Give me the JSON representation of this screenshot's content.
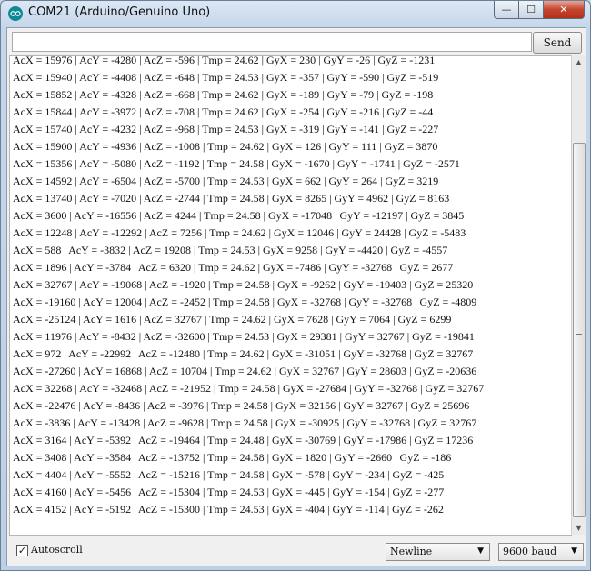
{
  "window": {
    "title": "COM21 (Arduino/Genuino Uno)"
  },
  "caption_buttons": {
    "min": "—",
    "max": "☐",
    "close": "✕"
  },
  "send": {
    "input_value": "",
    "button_label": "Send"
  },
  "output_lines": [
    "AcX = 15976 | AcY = -4280 | AcZ = -596 | Tmp = 24.62 | GyX = 230 | GyY = -26 | GyZ = -1231",
    "AcX = 15940 | AcY = -4408 | AcZ = -648 | Tmp = 24.53 | GyX = -357 | GyY = -590 | GyZ = -519",
    "AcX = 15852 | AcY = -4328 | AcZ = -668 | Tmp = 24.62 | GyX = -189 | GyY = -79 | GyZ = -198",
    "AcX = 15844 | AcY = -3972 | AcZ = -708 | Tmp = 24.62 | GyX = -254 | GyY = -216 | GyZ = -44",
    "AcX = 15740 | AcY = -4232 | AcZ = -968 | Tmp = 24.53 | GyX = -319 | GyY = -141 | GyZ = -227",
    "AcX = 15900 | AcY = -4936 | AcZ = -1008 | Tmp = 24.62 | GyX = 126 | GyY = 111 | GyZ = 3870",
    "AcX = 15356 | AcY = -5080 | AcZ = -1192 | Tmp = 24.58 | GyX = -1670 | GyY = -1741 | GyZ = -2571",
    "AcX = 14592 | AcY = -6504 | AcZ = -5700 | Tmp = 24.53 | GyX = 662 | GyY = 264 | GyZ = 3219",
    "AcX = 13740 | AcY = -7020 | AcZ = -2744 | Tmp = 24.58 | GyX = 8265 | GyY = 4962 | GyZ = 8163",
    "AcX = 3600 | AcY = -16556 | AcZ = 4244 | Tmp = 24.58 | GyX = -17048 | GyY = -12197 | GyZ = 3845",
    "AcX = 12248 | AcY = -12292 | AcZ = 7256 | Tmp = 24.62 | GyX = 12046 | GyY = 24428 | GyZ = -5483",
    "AcX = 588 | AcY = -3832 | AcZ = 19208 | Tmp = 24.53 | GyX = 9258 | GyY = -4420 | GyZ = -4557",
    "AcX = 1896 | AcY = -3784 | AcZ = 6320 | Tmp = 24.62 | GyX = -7486 | GyY = -32768 | GyZ = 2677",
    "AcX = 32767 | AcY = -19068 | AcZ = -1920 | Tmp = 24.58 | GyX = -9262 | GyY = -19403 | GyZ = 25320",
    "AcX = -19160 | AcY = 12004 | AcZ = -2452 | Tmp = 24.58 | GyX = -32768 | GyY = -32768 | GyZ = -4809",
    "AcX = -25124 | AcY = 1616 | AcZ = 32767 | Tmp = 24.62 | GyX = 7628 | GyY = 7064 | GyZ = 6299",
    "AcX = 11976 | AcY = -8432 | AcZ = -32600 | Tmp = 24.53 | GyX = 29381 | GyY = 32767 | GyZ = -19841",
    "AcX = 972 | AcY = -22992 | AcZ = -12480 | Tmp = 24.62 | GyX = -31051 | GyY = -32768 | GyZ = 32767",
    "AcX = -27260 | AcY = 16868 | AcZ = 10704 | Tmp = 24.62 | GyX = 32767 | GyY = 28603 | GyZ = -20636",
    "AcX = 32268 | AcY = -32468 | AcZ = -21952 | Tmp = 24.58 | GyX = -27684 | GyY = -32768 | GyZ = 32767",
    "AcX = -22476 | AcY = -8436 | AcZ = -3976 | Tmp = 24.58 | GyX = 32156 | GyY = 32767 | GyZ = 25696",
    "AcX = -3836 | AcY = -13428 | AcZ = -9628 | Tmp = 24.58 | GyX = -30925 | GyY = -32768 | GyZ = 32767",
    "AcX = 3164 | AcY = -5392 | AcZ = -19464 | Tmp = 24.48 | GyX = -30769 | GyY = -17986 | GyZ = 17236",
    "AcX = 3408 | AcY = -3584 | AcZ = -13752 | Tmp = 24.58 | GyX = 1820 | GyY = -2660 | GyZ = -186",
    "AcX = 4404 | AcY = -5552 | AcZ = -15216 | Tmp = 24.58 | GyX = -578 | GyY = -234 | GyZ = -425",
    "AcX = 4160 | AcY = -5456 | AcZ = -15304 | Tmp = 24.53 | GyX = -445 | GyY = -154 | GyZ = -277",
    "AcX = 4152 | AcY = -5192 | AcZ = -15300 | Tmp = 24.53 | GyX = -404 | GyY = -114 | GyZ = -262"
  ],
  "bottom": {
    "autoscroll_label": "Autoscroll",
    "autoscroll_checked": true,
    "line_ending": "Newline",
    "baud_rate": "9600 baud"
  }
}
